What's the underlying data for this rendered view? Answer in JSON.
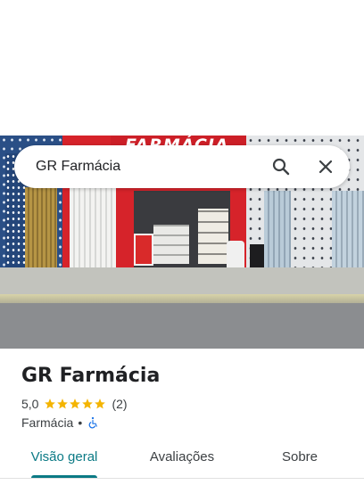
{
  "photo": {
    "sign_text": "FARMÁCIA",
    "description_icon": "storefront-photo"
  },
  "search": {
    "query": "GR Farmácia",
    "search_icon": "search-icon",
    "close_icon": "close-icon"
  },
  "place": {
    "name": "GR Farmácia",
    "rating": "5,0",
    "rating_stars": 5,
    "review_count": "(2)",
    "category": "Farmácia",
    "separator": "•",
    "accessibility_icon": "wheelchair-icon"
  },
  "tabs": [
    {
      "label": "Visão geral",
      "active": true
    },
    {
      "label": "Avaliações",
      "active": false
    },
    {
      "label": "Sobre",
      "active": false
    }
  ],
  "colors": {
    "accent": "#0b7a85",
    "star": "#f4b400",
    "wheelchair": "#1a73e8",
    "text": "#202124"
  }
}
